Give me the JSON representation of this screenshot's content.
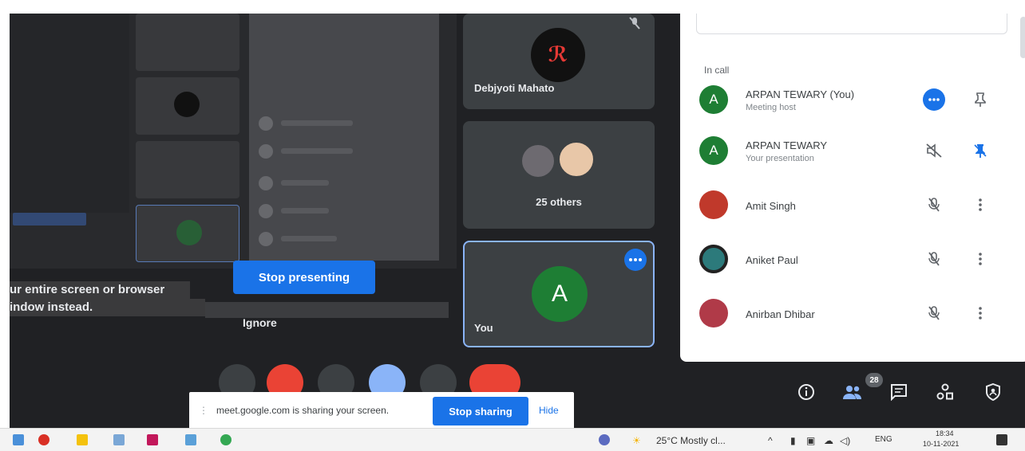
{
  "shared_screen": {
    "message_line1": "ur entire screen or browser",
    "message_line2": "indow instead.",
    "stop_presenting": "Stop presenting",
    "ignore": "Ignore"
  },
  "tiles": {
    "debjyoti": {
      "name": "Debjyoti Mahato"
    },
    "others": {
      "label": "25 others"
    },
    "you": {
      "name": "You",
      "initial": "A"
    }
  },
  "people_panel": {
    "section_label": "In call",
    "participants": [
      {
        "name": "ARPAN TEWARY (You)",
        "subtitle": "Meeting host",
        "initial": "A",
        "avatar_color": "#1e7e34"
      },
      {
        "name": "ARPAN TEWARY",
        "subtitle": "Your presentation",
        "initial": "A",
        "avatar_color": "#1e7e34"
      },
      {
        "name": "Amit Singh",
        "subtitle": "",
        "initial": "",
        "avatar_color": "#c0392b"
      },
      {
        "name": "Aniket Paul",
        "subtitle": "",
        "initial": "",
        "avatar_color": "#2c7a7b"
      },
      {
        "name": "Anirban Dhibar",
        "subtitle": "",
        "initial": "",
        "avatar_color": "#b03a48"
      }
    ]
  },
  "toolbar": {
    "people_count": "28",
    "icons": [
      "info-icon",
      "people-icon",
      "chat-icon",
      "activities-icon",
      "host-controls-icon"
    ]
  },
  "share_bar": {
    "text": "meet.google.com is sharing your screen.",
    "stop_sharing": "Stop sharing",
    "hide": "Hide"
  },
  "taskbar": {
    "weather": "25°C  Mostly cl...",
    "language": "ENG",
    "time": "18:34",
    "date": "10-11-2021"
  },
  "colors": {
    "meet_bg": "#202124",
    "accent_blue": "#1a73e8",
    "avatar_green": "#1e7e34"
  }
}
